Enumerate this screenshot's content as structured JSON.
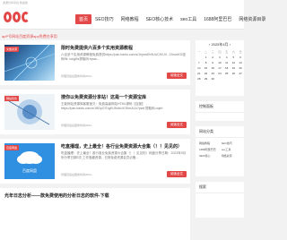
{
  "site": {
    "topbar_text": "资源分享平台 欢迎您",
    "banner_text": "apP号网站百度资源app免费在享用",
    "brand_color": "#e34848"
  },
  "nav": {
    "items": [
      {
        "label": "首页",
        "active": true
      },
      {
        "label": "SEO技巧"
      },
      {
        "label": "网络教程"
      },
      {
        "label": "SEO核心技术"
      },
      {
        "label": "seo工具"
      },
      {
        "label": "1688阿里巴巴"
      },
      {
        "label": "网络资源目录"
      }
    ]
  },
  "posts": [
    {
      "tag": "文章资源",
      "title": "限时免费提供六百多个实用资源教程",
      "desc": "六百多个实用资源教程免费提供https://pan.baidu.com/s/1hyxwEh9UUCKIUV...ChnwiXG密码f5t: lokjyBz提取码:byws...",
      "meta": "管理员最后更新时间2024...",
      "read": "阅读全文"
    },
    {
      "tag": "网站优化",
      "title": "搜你以免费资源分享站！这是一个资源宝库",
      "desc": "王能网站资源库客服宝贝：免费高级网站HTML源码【百度】https://pan.baidu.com/s/1BDyO7l1gKUNxbcVOKmA1A?pwd 提取码:oqeb",
      "meta": "管理员最后更新时间2024...",
      "read": "阅读全文"
    },
    {
      "tag": "百度网盘",
      "title": "吃盒播理，史上最全！各行业免费资源大合集（！！见见的）",
      "desc": "吃盒播理：史上最全！各行各业免费资源大合集（！！见见的）网盘分享日期：2023年9月份分享日期3次 工作宝藏资源，日常免费资源会员必备...",
      "meta": "管理员最后更新时间2024...",
      "read": "阅读全文"
    },
    {
      "tag": "",
      "title": "光年日志分析——款免费使用的分析日志的软件-下载",
      "desc": "",
      "meta": "",
      "read": ""
    }
  ],
  "thumb_labels": {
    "third": "百度网盘"
  },
  "sidebar": {
    "calendar": {
      "header": "2025年4月",
      "prev": "‹",
      "next": "›",
      "weekdays": [
        "一",
        "二",
        "三",
        "四",
        "五",
        "六",
        "日"
      ],
      "weeks": [
        [
          "",
          "1",
          "2",
          "3",
          "4",
          "5",
          "6"
        ],
        [
          "7",
          "8",
          "9",
          "10",
          "11",
          "12",
          "13"
        ],
        [
          "14",
          "15",
          "16",
          "17",
          "18",
          "19",
          "20"
        ],
        [
          "21",
          "22",
          "23",
          "24",
          "25",
          "26",
          "27"
        ],
        [
          "28",
          "29",
          "30",
          "",
          "",
          "",
          ""
        ]
      ]
    },
    "control_title": "控制面板",
    "links_title": "网站分类",
    "search_title": "搜索",
    "links": [
      "网络教程",
      "SEO技巧",
      "1688阿里巴巴",
      "seo工具",
      "SEO核心",
      "网络资源"
    ]
  }
}
